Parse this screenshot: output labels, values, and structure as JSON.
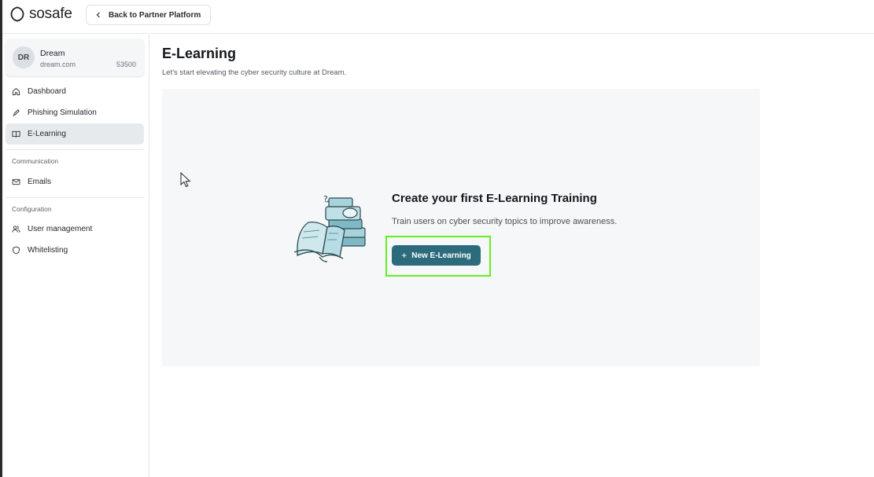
{
  "app": {
    "logo_text": "sosafe",
    "back_label": "Back to Partner Platform"
  },
  "account": {
    "initials": "DR",
    "name": "Dream",
    "domain": "dream.com",
    "id": "53500"
  },
  "sidebar": {
    "items": [
      {
        "label": "Dashboard",
        "icon": "home-icon"
      },
      {
        "label": "Phishing Simulation",
        "icon": "hook-icon"
      },
      {
        "label": "E-Learning",
        "icon": "book-open-icon",
        "active": true
      }
    ],
    "sections": [
      {
        "title": "Communication",
        "items": [
          {
            "label": "Emails",
            "icon": "mail-icon"
          }
        ]
      },
      {
        "title": "Configuration",
        "items": [
          {
            "label": "User management",
            "icon": "users-icon"
          },
          {
            "label": "Whitelisting",
            "icon": "shield-icon"
          }
        ]
      }
    ]
  },
  "main": {
    "title": "E-Learning",
    "subtitle": "Let's start elevating the cyber security culture at Dream.",
    "empty_state": {
      "title": "Create your first E-Learning Training",
      "description": "Train users on cyber security topics to improve awareness.",
      "button_label": "New E-Learning"
    }
  },
  "colors": {
    "primary_button": "#2c6b7c",
    "highlight_box": "#66ee22",
    "active_nav_bg": "#e7eaed"
  }
}
